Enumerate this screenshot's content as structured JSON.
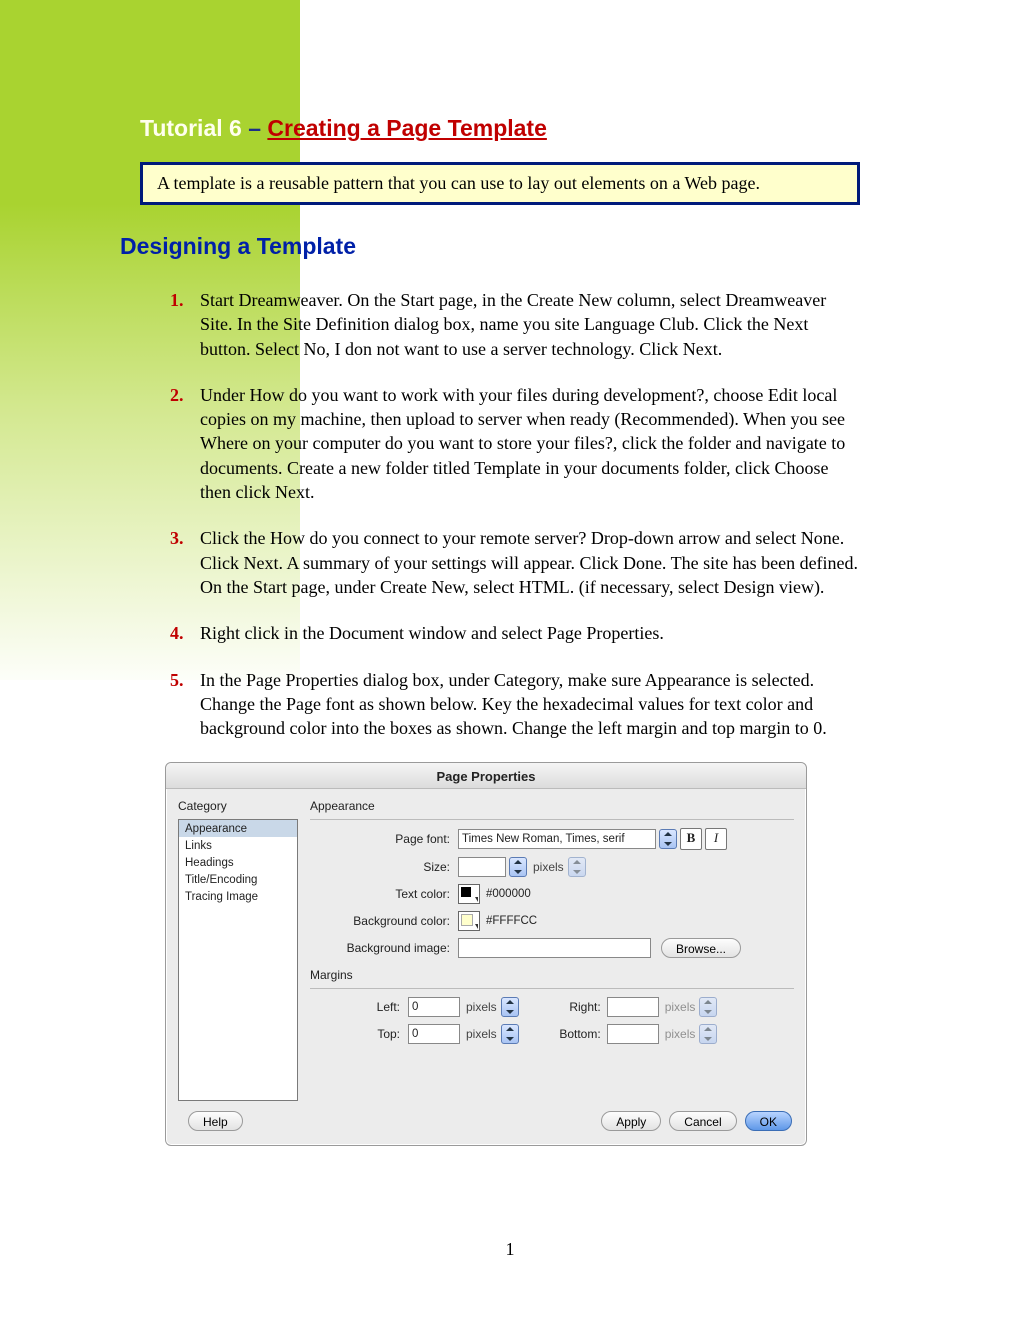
{
  "header": {
    "tutorial_label": "Tutorial 6",
    "dash": " – ",
    "title_red": "Creating a Page Template"
  },
  "callout": "A template is a reusable pattern that you can use to lay out elements on a Web page.",
  "section_heading": "Designing a Template",
  "steps": [
    "Start Dreamweaver.  On the Start page, in the Create New column, select Dreamweaver Site.  In the Site Definition dialog box, name you site Language Club.  Click the Next button.  Select No, I don not want to use a server technology.  Click Next.",
    "Under How do you want to work with your files during development?, choose Edit local copies on my machine, then upload to server when ready (Recommended).  When you see Where on your computer do you want to store your files?, click the folder and navigate to documents.  Create a new folder titled Template in your documents folder, click Choose then click Next.",
    "Click the How do you connect to your remote server? Drop-down arrow and select None.  Click Next.  A summary of your settings will appear.  Click Done.  The site has been defined.  On the Start page, under Create New, select HTML.  (if necessary, select Design view).",
    "Right click in the Document window and select Page Properties.",
    "In the Page Properties dialog box, under Category, make sure Appearance is selected.  Change the Page font as shown below.  Key the hexadecimal values for text color and background color into the boxes as shown.  Change the left margin and top margin to 0."
  ],
  "dialog": {
    "title": "Page Properties",
    "category_label": "Category",
    "categories": [
      "Appearance",
      "Links",
      "Headings",
      "Title/Encoding",
      "Tracing Image"
    ],
    "group_appearance": "Appearance",
    "labels": {
      "page_font": "Page font:",
      "size": "Size:",
      "text_color": "Text color:",
      "bg_color": "Background color:",
      "bg_image": "Background image:",
      "margins": "Margins",
      "left": "Left:",
      "right": "Right:",
      "top": "Top:",
      "bottom": "Bottom:"
    },
    "values": {
      "page_font": "Times New Roman, Times, serif",
      "size": "",
      "size_unit": "pixels",
      "text_color_hex": "#000000",
      "bg_color_hex": "#FFFFCC",
      "bg_image": "",
      "margin_left": "0",
      "margin_top": "0",
      "margin_right": "",
      "margin_bottom": "",
      "margin_unit": "pixels"
    },
    "buttons": {
      "browse": "Browse...",
      "help": "Help",
      "apply": "Apply",
      "cancel": "Cancel",
      "ok": "OK",
      "bold": "B",
      "italic": "I"
    }
  },
  "page_number": "1"
}
